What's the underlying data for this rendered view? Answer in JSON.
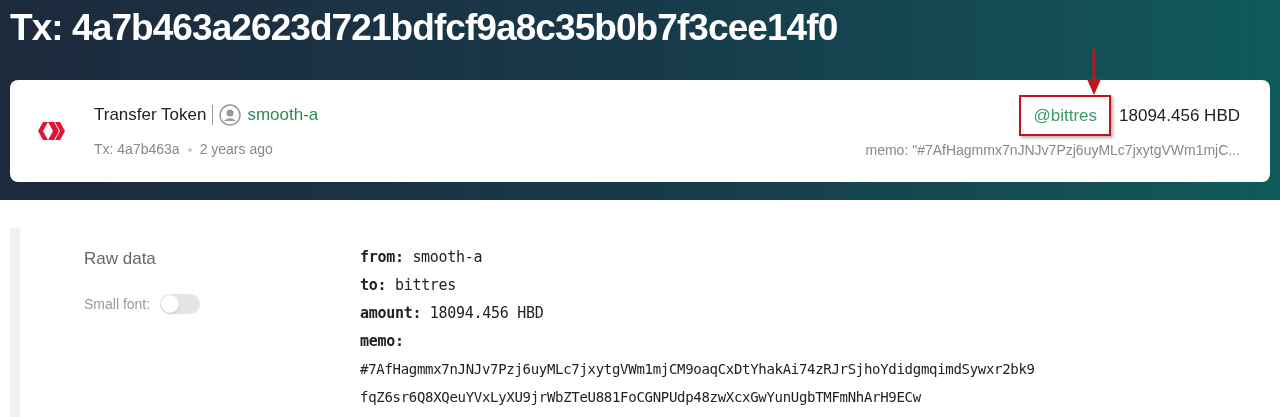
{
  "title": "Tx: 4a7b463a2623d721bdfcf9a8c35b0b7f3cee14f0",
  "operation": {
    "name": "Transfer Token",
    "account": "smooth-a",
    "tx": "Tx: 4a7b463a",
    "time": "2 years ago",
    "recipient": "@bittres",
    "amount": "18094.456 HBD",
    "memo": "memo: \"#7AfHagmmx7nJNJv7Pzj6uyMLc7jxytgVWm1mjC...",
    "highlighted": true
  },
  "raw": {
    "heading": "Raw data",
    "small_font": {
      "label": "Small font:",
      "on": false
    },
    "fields": [
      {
        "kind": "inline",
        "key": "from:",
        "value": "smooth-a"
      },
      {
        "kind": "inline",
        "key": "to:",
        "value": "bittres"
      },
      {
        "kind": "inline",
        "key": "amount:",
        "value": "18094.456 HBD"
      },
      {
        "kind": "block",
        "key": "memo:",
        "lines": [
          "#7AfHagmmx7nJNJv7Pzj6uyMLc7jxytgVWm1mjCM9oaqCxDtYhakAi74zRJrSjhoYdidgmqimdSywxr2bk9",
          "fqZ6sr6Q8XQeuYVxLyXU9jrWbZTeU881FoCGNPUdp48zwXcxGwYunUgbTMFmNhArH9ECw"
        ]
      }
    ]
  }
}
